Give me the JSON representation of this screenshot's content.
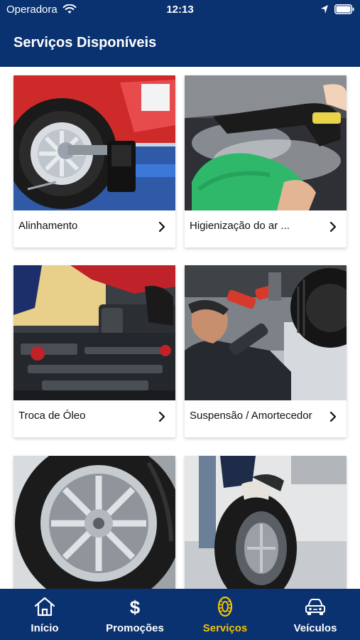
{
  "status_bar": {
    "carrier": "Operadora",
    "time": "12:13"
  },
  "header": {
    "title": "Serviços Disponíveis"
  },
  "services": [
    {
      "label": "Alinhamento"
    },
    {
      "label": "Higienização do ar ..."
    },
    {
      "label": "Troca de Óleo"
    },
    {
      "label": "Suspensão / Amortecedor"
    }
  ],
  "tabs": [
    {
      "label": "Início",
      "icon": "home-icon"
    },
    {
      "label": "Promoções",
      "icon": "dollar-icon"
    },
    {
      "label": "Serviços",
      "icon": "tire-icon",
      "active": true
    },
    {
      "label": "Veículos",
      "icon": "car-icon"
    }
  ],
  "colors": {
    "brand": "#0a3170",
    "active_tab": "#f4c400"
  }
}
